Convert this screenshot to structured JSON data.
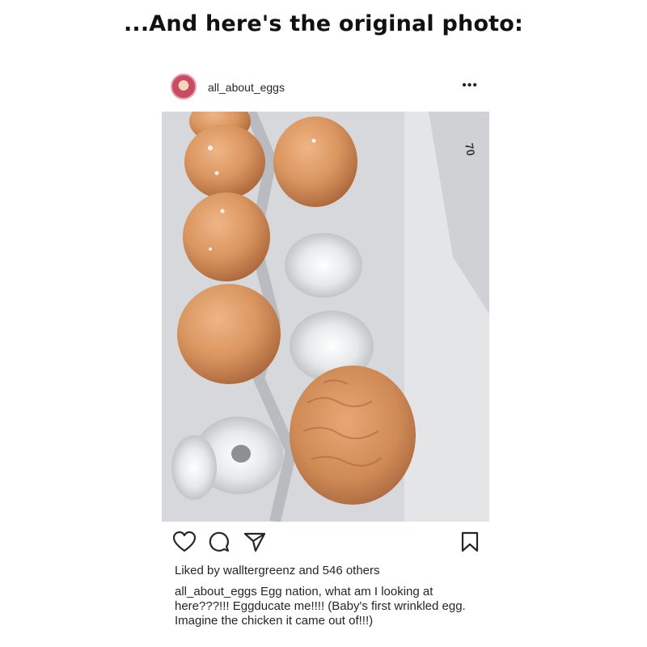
{
  "headline": "...And here's the original photo:",
  "post": {
    "username": "all_about_eggs",
    "more_label": "•••",
    "likes": {
      "liked_by_prefix": "Liked by",
      "liker": "walltergreenz",
      "suffix": "and 546 others"
    },
    "caption": {
      "handle": "all_about_eggs",
      "text": "Egg nation, what am I looking at here???!!! Eggducate me!!!! (Baby's first wrinkled egg. Imagine the chicken it came out of!!!)"
    },
    "icons": {
      "more": "more-options-icon",
      "like": "heart-icon",
      "comment": "comment-icon",
      "share": "send-icon",
      "save": "bookmark-icon"
    }
  },
  "carton_print": {
    "number": "70"
  },
  "colors": {
    "egg_brown": "#d9955f",
    "carton_gray": "#d6d8db",
    "text": "#262626"
  }
}
